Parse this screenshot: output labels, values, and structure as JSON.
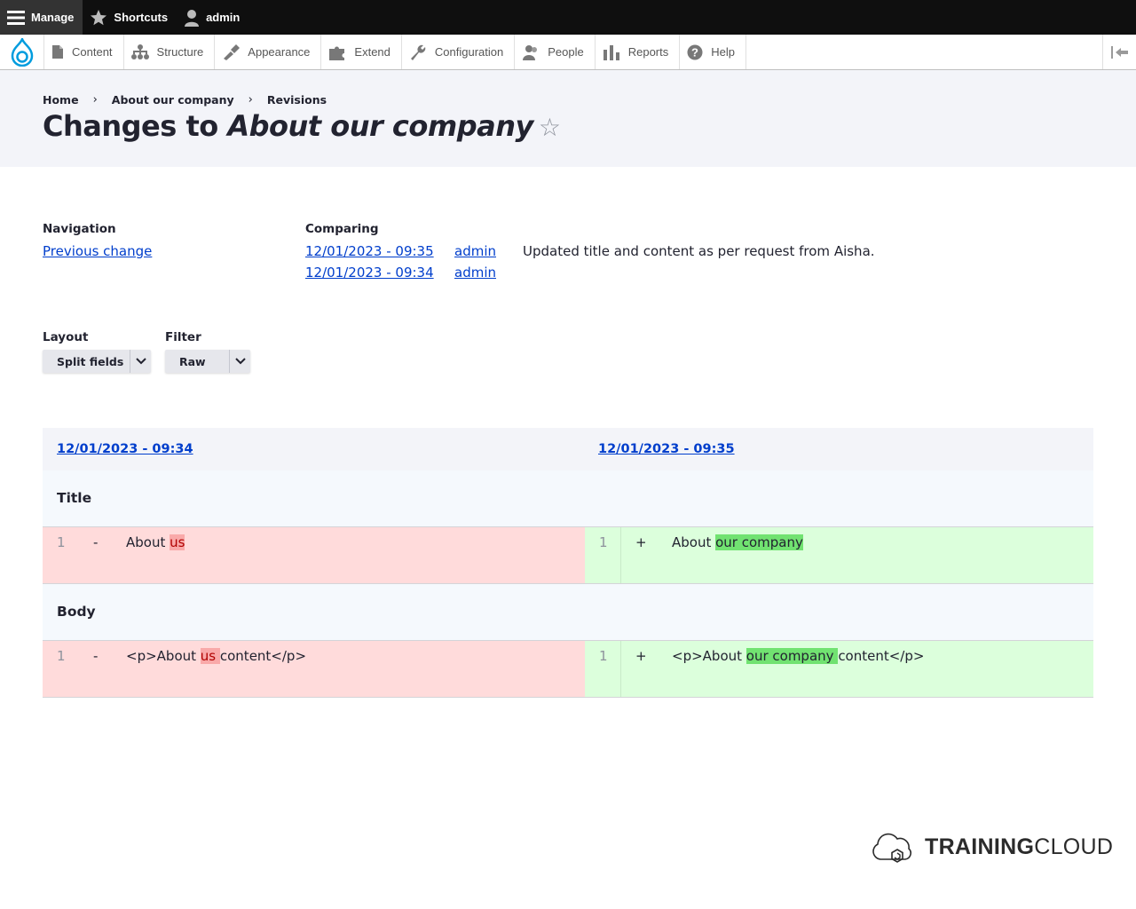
{
  "topbar": {
    "manage_label": "Manage",
    "shortcuts_label": "Shortcuts",
    "user_label": "admin"
  },
  "tray": {
    "items": [
      {
        "label": "Content",
        "icon": "file-icon"
      },
      {
        "label": "Structure",
        "icon": "sitemap-icon"
      },
      {
        "label": "Appearance",
        "icon": "paintbrush-icon"
      },
      {
        "label": "Extend",
        "icon": "puzzle-icon"
      },
      {
        "label": "Configuration",
        "icon": "wrench-icon"
      },
      {
        "label": "People",
        "icon": "people-icon"
      },
      {
        "label": "Reports",
        "icon": "bar-chart-icon"
      },
      {
        "label": "Help",
        "icon": "question-icon"
      }
    ]
  },
  "breadcrumb": [
    "Home",
    "About our company",
    "Revisions"
  ],
  "page": {
    "title_prefix": "Changes to ",
    "title_node": "About our company"
  },
  "navigation": {
    "label": "Navigation",
    "previous_change": "Previous change"
  },
  "comparing": {
    "label": "Comparing",
    "rows": [
      {
        "date": "12/01/2023 - 09:35",
        "author": "admin",
        "message": "Updated title and content as per request from Aisha."
      },
      {
        "date": "12/01/2023 - 09:34",
        "author": "admin",
        "message": ""
      }
    ]
  },
  "controls": {
    "layout_label": "Layout",
    "layout_value": "Split fields",
    "filter_label": "Filter",
    "filter_value": "Raw"
  },
  "diff": {
    "left_revision": "12/01/2023 - 09:34",
    "right_revision": "12/01/2023 - 09:35",
    "fields": [
      {
        "name": "Title",
        "line": "1",
        "left_sign": "-",
        "right_sign": "+",
        "left": {
          "before": "About ",
          "changed": "us",
          "after": ""
        },
        "right": {
          "before": "About ",
          "changed": "our company",
          "after": ""
        }
      },
      {
        "name": "Body",
        "line": "1",
        "left_sign": "-",
        "right_sign": "+",
        "left": {
          "before": "<p>About ",
          "changed": "us ",
          "after": "content</p>"
        },
        "right": {
          "before": "<p>About ",
          "changed": "our company ",
          "after": "content</p>"
        }
      }
    ]
  },
  "brand": {
    "bold": "TRAINING",
    "light": "CLOUD"
  },
  "colors": {
    "link": "#003ecc",
    "deleted_bg": "#ffdbdb",
    "added_bg": "#dcffdc",
    "deleted_highlight": "#f9a9a9",
    "added_highlight": "#71e271"
  }
}
